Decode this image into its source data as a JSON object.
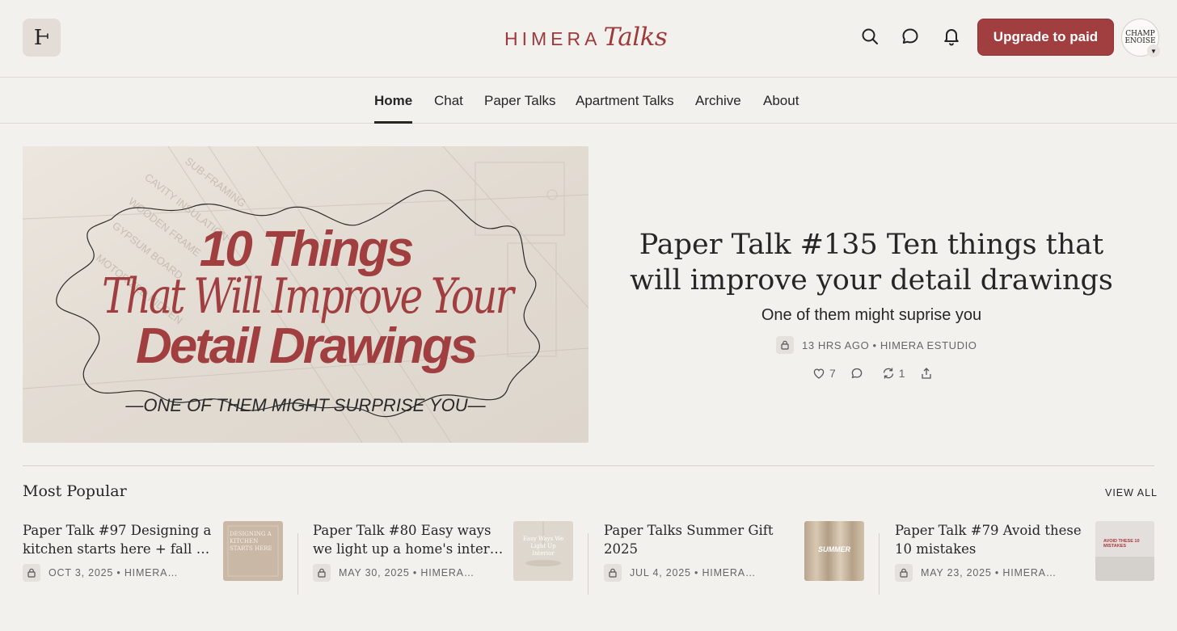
{
  "header": {
    "logo_glyph": "Ⱶ",
    "brand_main": "HIMERA",
    "brand_script": "Talks",
    "upgrade_label": "Upgrade to paid",
    "avatar_text_1": "CHAMP",
    "avatar_text_2": "ENOISE"
  },
  "nav": {
    "items": [
      {
        "label": "Home",
        "active": true
      },
      {
        "label": "Chat"
      },
      {
        "label": "Paper Talks"
      },
      {
        "label": "Apartment Talks"
      },
      {
        "label": "Archive"
      },
      {
        "label": "About"
      }
    ]
  },
  "hero": {
    "image_line1": "10 Things",
    "image_line2": "That Will Improve Your",
    "image_line3": "Detail Drawings",
    "image_tagline": "—ONE OF THEM MIGHT SURPRISE YOU—",
    "title": "Paper Talk #135 Ten things that will improve your detail drawings",
    "subtitle": "One of them might suprise you",
    "meta": "13 HRS AGO • HIMERA ESTUDIO",
    "likes": "7",
    "restacks": "1"
  },
  "most_popular": {
    "title": "Most Popular",
    "view_all": "VIEW ALL",
    "cards": [
      {
        "title_line1": "Paper Talk #97 Designing a",
        "title_line2": "kitchen starts here + fall gi…",
        "meta": "OCT 3, 2025 • HIMERA…",
        "thumb_text": "DESIGNING A KITCHEN STARTS HERE"
      },
      {
        "title_line1": "Paper Talk #80 Easy ways",
        "title_line2": "we light up a home's interior",
        "meta": "MAY 30, 2025 • HIMERA…",
        "thumb_text": "Easy Ways We Light Up Interior"
      },
      {
        "title_line1": "Paper Talks Summer Gift",
        "title_line2": "2025",
        "meta": "JUL 4, 2025 • HIMERA…",
        "thumb_text": "SUMMER"
      },
      {
        "title_line1": "Paper Talk #79 Avoid these",
        "title_line2": "10 mistakes",
        "meta": "MAY 23, 2025 • HIMERA…",
        "thumb_text": "AVOID THESE 10 MISTAKES"
      }
    ]
  },
  "colors": {
    "accent": "#a03e40",
    "background": "#f3f1ee",
    "text": "#262626"
  }
}
